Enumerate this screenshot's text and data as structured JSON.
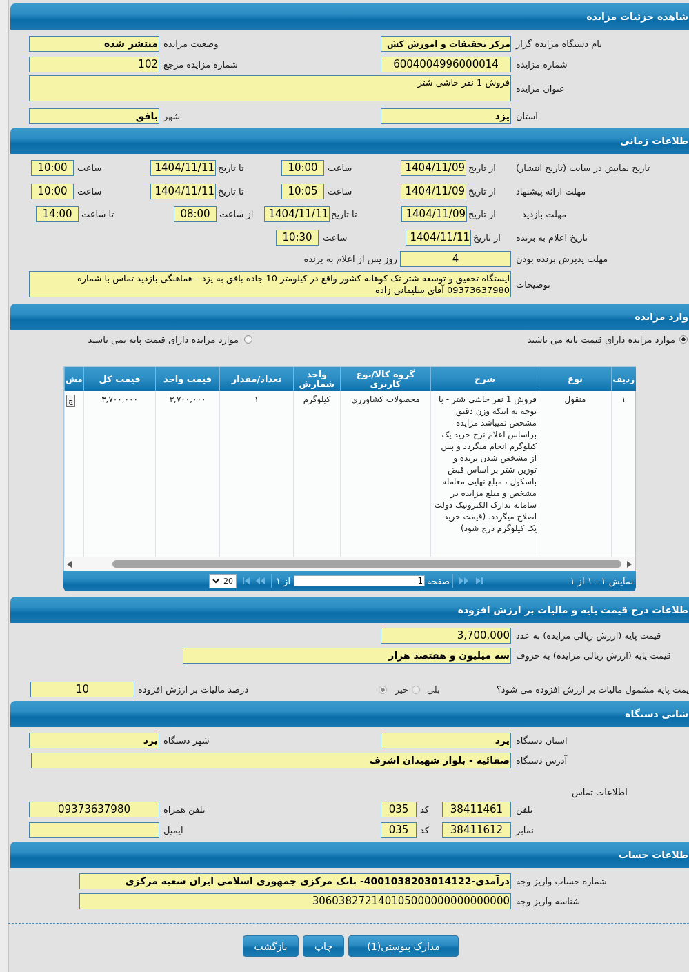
{
  "auction_details": {
    "title": "شاهده جزئیات مزایده",
    "organizer": {
      "label": "نام دستگاه مزایده گزار",
      "value": "مرکز تحقیقات و اموزش کش"
    },
    "status": {
      "label": "وضعیت مزایده",
      "value": "منتشر شده"
    },
    "auction_number": {
      "label": "شماره مزایده",
      "value": "6004004996000014"
    },
    "reference_number": {
      "label": "شماره مزایده مرجع",
      "value": "102"
    },
    "auction_title": {
      "label": "عنوان مزایده",
      "value": "فروش 1 نفر حاشی شتر"
    },
    "province": {
      "label": "استان",
      "value": "یزد"
    },
    "city": {
      "label": "شهر",
      "value": "بافق"
    }
  },
  "timing": {
    "title": "طلاعات زمانی",
    "publish": {
      "label": "تاریخ نمایش در سایت (تاریخ انتشار)",
      "from_date_label": "از تاریخ",
      "from_date": "1404/11/09",
      "from_time_label": "ساعت",
      "from_time": "10:00",
      "to_date_label": "تا تاریخ",
      "to_date": "1404/11/11",
      "to_time_label": "ساعت",
      "to_time": "10:00"
    },
    "offer": {
      "label": "مهلت ارائه پیشنهاد",
      "from_date_label": "از تاریخ",
      "from_date": "1404/11/09",
      "from_time_label": "ساعت",
      "from_time": "10:05",
      "to_date_label": "تا تاریخ",
      "to_date": "1404/11/11",
      "to_time_label": "ساعت",
      "to_time": "10:00"
    },
    "visit": {
      "label": "مهلت بازدید",
      "from_date_label": "از تاریخ",
      "from_date": "1404/11/09",
      "to_date_label": "تا تاریخ",
      "to_date": "1404/11/11",
      "from_time_label": "از ساعت",
      "from_time": "08:00",
      "to_time_label": "تا ساعت",
      "to_time": "14:00"
    },
    "announcement": {
      "label": "تاریخ اعلام به برنده",
      "date_label": "از تاریخ",
      "date": "1404/11/11",
      "time_label": "ساعت",
      "time": "10:30"
    },
    "acceptance": {
      "label": "مهلت پذیرش برنده بودن",
      "value": "4",
      "suffix": "روز پس از اعلام به برنده"
    },
    "notes": {
      "label": "توضیحات",
      "value": "ایستگاه تحقیق و توسعه شتر تک کوهانه کشور واقع در کیلومتر 10 جاده بافق به یزد - هماهنگی بازدید تماس با شماره 09373637980 آقای سلیمانی زاده"
    }
  },
  "items": {
    "title": "وارد مزایده",
    "price_options": [
      {
        "label": "موارد مزایده دارای قیمت پایه می باشند",
        "selected": true
      },
      {
        "label": "موارد مزایده دارای قیمت پایه نمی باشند",
        "selected": false
      }
    ],
    "table": {
      "columns": [
        "ردیف",
        "نوع",
        "شرح",
        "گروه کالا/نوع کاربری",
        "واحد شمارش",
        "تعداد/مقدار",
        "قیمت واحد",
        "قیمت کل",
        "مش"
      ],
      "rows": [
        {
          "cells": [
            "۱",
            "منقول",
            "فروش 1 نفر حاشی شتر - با توجه به اینکه وزن دقیق مشخص نمیباشد مزایده براساس اعلام نرخ خرید یک کیلوگرم انجام میگردد و پس از مشخص شدن برنده و توزین شتر بر اساس قبض باسکول ، مبلغ نهایی معامله مشخص و مبلغ مزایده در سامانه تدارک الکترونیک دولت اصلاح میگردد. (قیمت خرید یک کیلوگرم درج شود)",
            "محصولات کشاورزی",
            "کیلوگرم",
            "۱",
            "۳,۷۰۰,۰۰۰",
            "۳,۷۰۰,۰۰۰"
          ],
          "action": "ج"
        }
      ]
    },
    "pager": {
      "summary": "نمایش ۱ - ۱ از ۱",
      "page_label": "صفحه",
      "page": "1",
      "page_count": "از ۱",
      "page_size": "20",
      "nav": [
        {
          "kind": "first",
          "disabled": true
        },
        {
          "kind": "prev",
          "disabled": true
        },
        {
          "kind": "next",
          "disabled": true
        },
        {
          "kind": "last",
          "disabled": true
        }
      ]
    }
  },
  "base_price": {
    "title": "طلاعات درج قیمت پایه و مالیات بر ارزش افزوده",
    "amount": {
      "label": "قیمت پایه (ارزش ریالی مزایده) به عدد",
      "value": "3,700,000"
    },
    "amount_words": {
      "label": "قیمت پایه (ارزش ریالی مزایده) به حروف",
      "value": "سه میلیون و هفتصد هزار"
    },
    "vat_question": {
      "label": "یمت پایه مشمول مالیات بر ارزش افزوده می شود؟",
      "disabled": true,
      "options": [
        {
          "label": "بلی",
          "selected": false
        },
        {
          "label": "خیر",
          "selected": true
        }
      ]
    },
    "vat_percent": {
      "label": "درصد مالیات بر ارزش افزوده",
      "value": "10"
    }
  },
  "organization_address": {
    "title": "شانی دستگاه",
    "province": {
      "label": "استان دستگاه",
      "value": "یزد"
    },
    "city": {
      "label": "شهر دستگاه",
      "value": "یزد"
    },
    "address": {
      "label": "آدرس دستگاه",
      "value": "صفائیه - بلوار شهیدان اشرف"
    },
    "contact_title": "اطلاعات تماس",
    "phone": {
      "label": "تلفن",
      "value": "38411461",
      "code_label": "کد",
      "code": "035"
    },
    "fax": {
      "label": "نمابر",
      "value": "38411612",
      "code_label": "کد",
      "code": "035"
    },
    "mobile": {
      "label": "تلفن همراه",
      "value": "09373637980"
    },
    "email": {
      "label": "ایمیل"
    }
  },
  "account": {
    "title": "طلاعات حساب",
    "account_number": {
      "label": "شماره حساب واریز وجه",
      "value": "درآمدی-4001038203014122- بانک مرکزی جمهوری اسلامی ایران شعبه مرکزی"
    },
    "payment_id": {
      "label": "شناسه واریز وجه",
      "value": "306038272140105000000000000000"
    }
  },
  "buttons": [
    "مدارک پیوستی(1)",
    "چاپ",
    "بازگشت"
  ]
}
